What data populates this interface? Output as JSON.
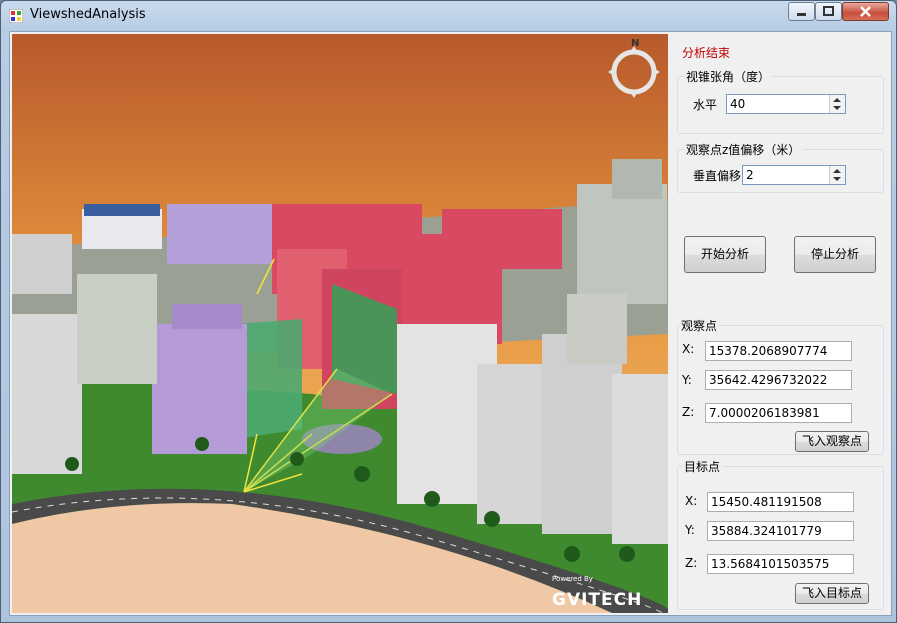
{
  "window": {
    "title": "ViewshedAnalysis"
  },
  "panel": {
    "heading": "分析结束",
    "fov": {
      "legend": "视锥张角（度）",
      "label": "水平",
      "value": "40"
    },
    "offset": {
      "legend": "观察点z值偏移（米）",
      "label": "垂直偏移",
      "value": "2"
    },
    "start_label": "开始分析",
    "stop_label": "停止分析",
    "observer": {
      "legend": "观察点",
      "x_label": "X:",
      "x": "15378.2068907774",
      "y_label": "Y:",
      "y": "35642.4296732022",
      "z_label": "Z:",
      "z": "7.0000206183981",
      "fly_label": "飞入观察点"
    },
    "target": {
      "legend": "目标点",
      "x_label": "X:",
      "x": "15450.481191508",
      "y_label": "Y:",
      "y": "35884.324101779",
      "z_label": "Z:",
      "z": "13.5684101503575",
      "fly_label": "飞入目标点"
    }
  },
  "viewport": {
    "compass_letter": "N",
    "logo_small": "Powered By",
    "logo": "GVITECH"
  },
  "colors": {
    "visible": "#3aa05a",
    "hidden": "#e0304a",
    "status": "#c00000"
  }
}
